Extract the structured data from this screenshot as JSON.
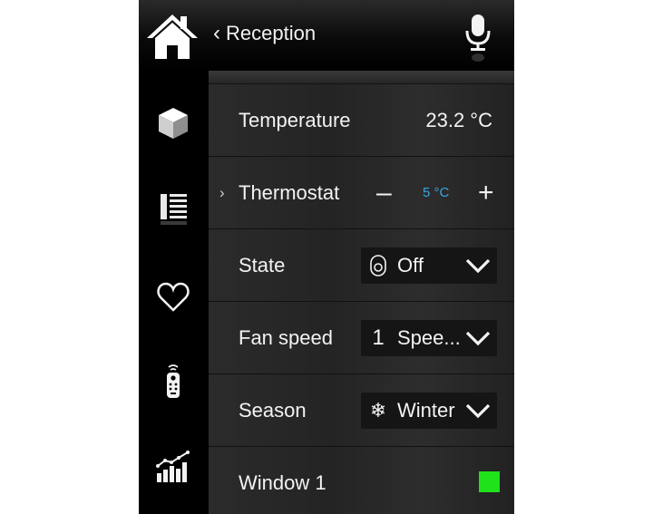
{
  "header": {
    "back_label": "Reception",
    "icons": {
      "home": "home-icon",
      "back": "chevron-left-icon",
      "mic": "microphone-icon"
    }
  },
  "sidebar": {
    "items": [
      {
        "icon": "cube-icon"
      },
      {
        "icon": "list-panel-icon"
      },
      {
        "icon": "heart-icon"
      },
      {
        "icon": "remote-control-icon"
      },
      {
        "icon": "bar-chart-icon"
      }
    ]
  },
  "rows": {
    "temperature": {
      "label": "Temperature",
      "value": "23.2 °C"
    },
    "thermostat": {
      "label": "Thermostat",
      "setpoint": "5 °C",
      "minus": "–",
      "plus": "+",
      "expand": "›"
    },
    "state": {
      "label": "State",
      "selected": "Off",
      "icon": "power-knob-icon"
    },
    "fan_speed": {
      "label": "Fan speed",
      "selected": "Spee...",
      "icon": "fan-speed-one-icon",
      "glyph": "1"
    },
    "season": {
      "label": "Season",
      "selected": "Winter",
      "icon": "snowflake-icon",
      "glyph": "❄"
    },
    "window": {
      "label": "Window 1",
      "status_color": "#1fe21a"
    }
  },
  "colors": {
    "accent": "#39a6e8",
    "status_on": "#1fe21a"
  }
}
